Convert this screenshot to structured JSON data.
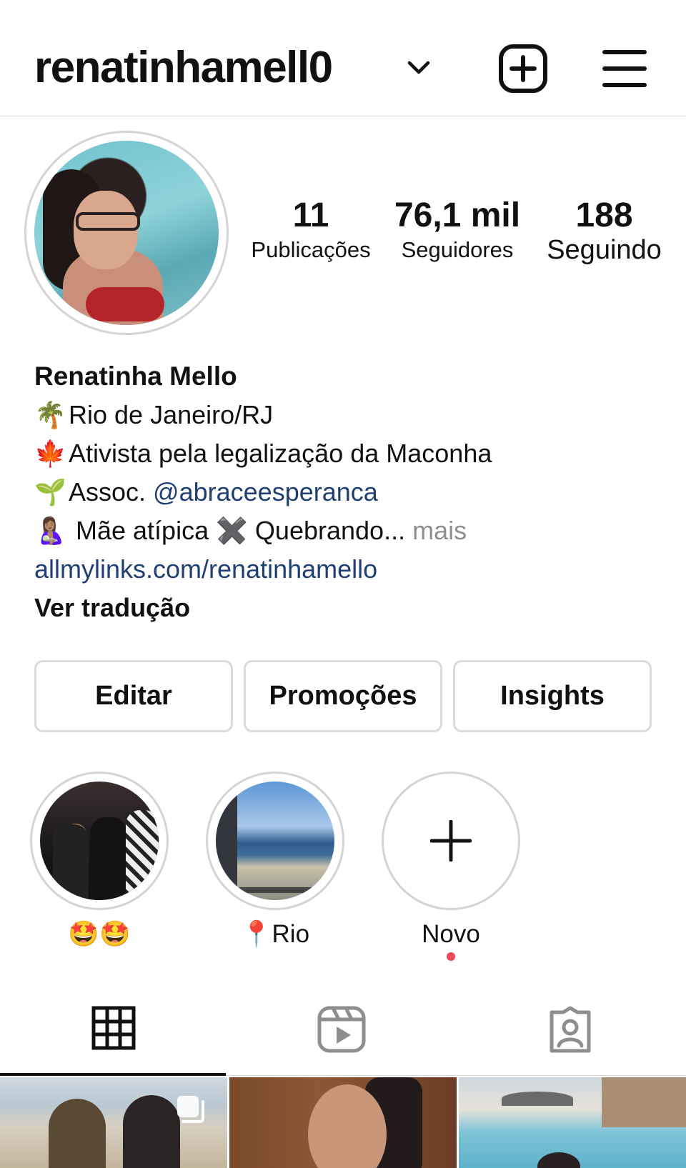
{
  "header": {
    "username": "renatinhamell0",
    "dropdown_icon": "chevron-down-icon",
    "new_post_icon": "plus-square-icon",
    "menu_icon": "hamburger-menu-icon"
  },
  "profile": {
    "avatar": "profile-photo",
    "stats": {
      "posts": {
        "value": "11",
        "label": "Publicações"
      },
      "followers": {
        "value": "76,1 mil",
        "label": "Seguidores"
      },
      "following": {
        "value": "188",
        "label": "Seguindo"
      }
    }
  },
  "bio": {
    "name": "Renatinha Mello",
    "lines": [
      {
        "emoji": "🌴",
        "text": "Rio de Janeiro/RJ"
      },
      {
        "emoji": "🍁",
        "text": "Ativista pela legalização da Maconha"
      },
      {
        "emoji": "🌱",
        "text": "Assoc. ",
        "mention": "@abraceesperanca"
      },
      {
        "emoji": "🤱🏽",
        "text": " Mãe atípica ✖️ Quebrando...",
        "more": " mais"
      }
    ],
    "link": "allmylinks.com/renatinhamello",
    "translate": "Ver tradução"
  },
  "buttons": {
    "edit": "Editar",
    "promotions": "Promoções",
    "insights": "Insights"
  },
  "highlights": [
    {
      "label": "🤩🤩"
    },
    {
      "label": "📍Rio"
    },
    {
      "label": "Novo"
    }
  ],
  "tabs": [
    {
      "icon": "grid-icon",
      "active": true
    },
    {
      "icon": "reels-icon",
      "active": false
    },
    {
      "icon": "tagged-icon",
      "active": false
    }
  ],
  "colors": {
    "link": "#1f3f73",
    "muted": "#8e8e8e",
    "border": "#dbdbdb",
    "notification_dot": "#ed4956"
  }
}
